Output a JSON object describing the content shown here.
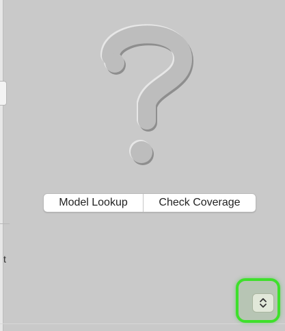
{
  "help_panel": {
    "icon": "question-mark-icon",
    "buttons": {
      "model_lookup": "Model Lookup",
      "check_coverage": "Check Coverage"
    }
  },
  "left_edge": {
    "truncated_text": "t"
  },
  "stepper": {
    "icon": "chevron-up-down-icon",
    "highlight_color": "#3ee02b"
  }
}
